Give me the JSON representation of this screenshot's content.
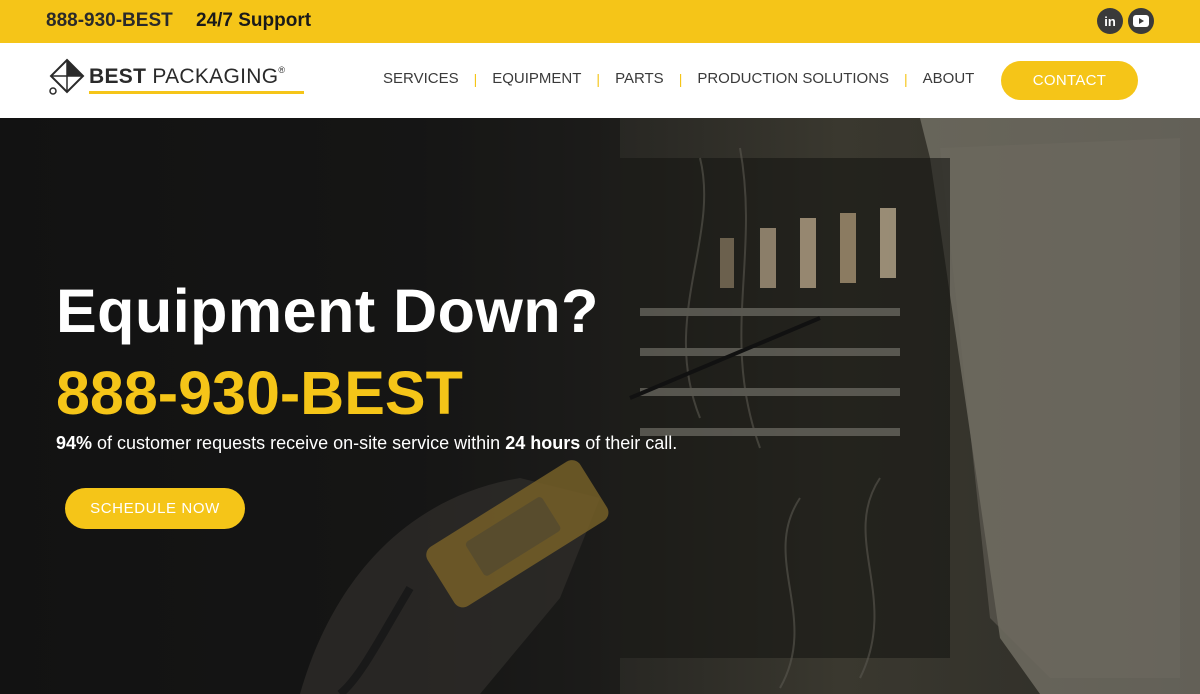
{
  "topbar": {
    "phone": "888-930-BEST",
    "support": "24/7 Support",
    "social": [
      {
        "name": "linkedin-icon",
        "glyph": "in"
      },
      {
        "name": "youtube-icon",
        "glyph": "play"
      }
    ]
  },
  "header": {
    "brand_bold": "BEST",
    "brand_rest": " PACKAGING",
    "brand_reg": "®",
    "nav": [
      "SERVICES",
      "EQUIPMENT",
      "PARTS",
      "PRODUCTION SOLUTIONS",
      "ABOUT"
    ],
    "nav_separator": "|",
    "contact_label": "CONTACT"
  },
  "hero": {
    "headline": "Equipment Down?",
    "phone": "888-930-BEST",
    "sub_pct": "94%",
    "sub_mid": " of customer requests receive on-site service within ",
    "sub_hours": "24 hours",
    "sub_end": " of their call.",
    "cta_label": "SCHEDULE NOW"
  },
  "colors": {
    "accent": "#f5c518",
    "text_dark": "#2a2a2a",
    "white": "#ffffff"
  }
}
